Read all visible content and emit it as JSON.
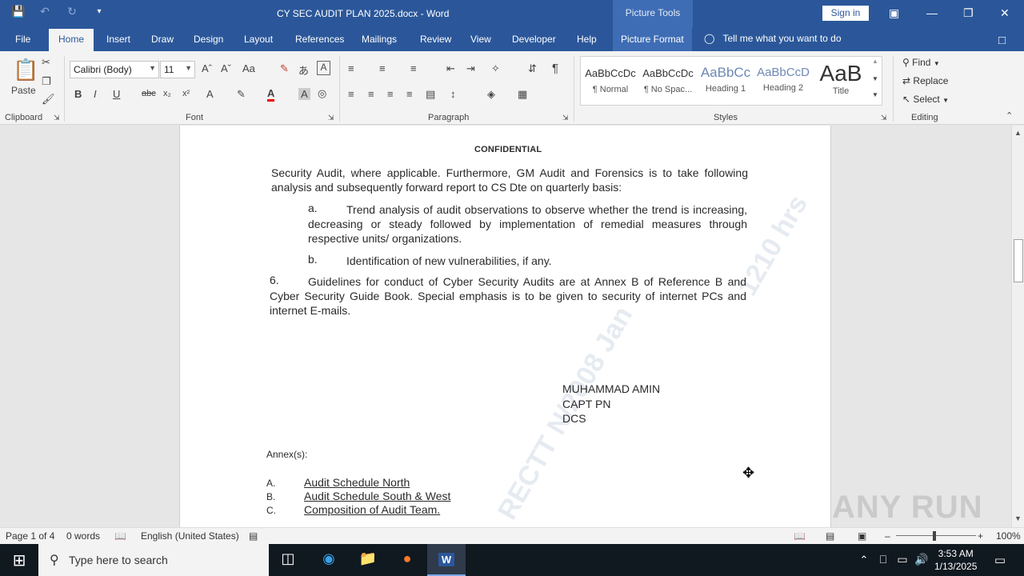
{
  "window": {
    "title": "CY SEC AUDIT PLAN 2025.docx  -  Word",
    "context_tab": "Picture Tools",
    "sign_in": "Sign in"
  },
  "tabs": [
    "File",
    "Home",
    "Insert",
    "Draw",
    "Design",
    "Layout",
    "References",
    "Mailings",
    "Review",
    "View",
    "Developer",
    "Help",
    "Picture Format"
  ],
  "tell_me": "Tell me what you want to do",
  "ribbon": {
    "clipboard": {
      "label": "Clipboard",
      "paste": "Paste"
    },
    "font": {
      "label": "Font",
      "name": "Calibri (Body)",
      "size": "11"
    },
    "paragraph": {
      "label": "Paragraph"
    },
    "styles": {
      "label": "Styles",
      "items": [
        {
          "sample": "AaBbCcDc",
          "name": "¶ Normal"
        },
        {
          "sample": "AaBbCcDc",
          "name": "¶ No Spac..."
        },
        {
          "sample": "AaBbCc",
          "name": "Heading 1"
        },
        {
          "sample": "AaBbCcD",
          "name": "Heading 2"
        },
        {
          "sample": "AaB",
          "name": "Title"
        }
      ]
    },
    "editing": {
      "label": "Editing",
      "find": "Find",
      "replace": "Replace",
      "select": "Select"
    }
  },
  "document": {
    "header": "CONFIDENTIAL",
    "para_intro": "Security Audit, where applicable.  Furthermore, GM Audit and Forensics is to take following analysis and subsequently forward report to CS Dte on quarterly basis:",
    "item_a_letter": "a.",
    "item_a": "Trend analysis of audit observations to observe whether the trend is increasing, decreasing or steady followed by implementation of remedial measures through respective units/ organizations.",
    "item_b_letter": "b.",
    "item_b": "Identification of new vulnerabilities, if any.",
    "para6_num": "6.",
    "para6": "Guidelines for conduct of Cyber Security Audits are at Annex B of Reference B and Cyber Security Guide Book.  Special emphasis is to be given to security of internet PCs and internet E-mails.",
    "signature": {
      "name": "MUHAMMAD AMIN",
      "rank": "CAPT PN",
      "appointment": "DCS"
    },
    "annex_heading": "Annex(s):",
    "annexes": [
      {
        "letter": "A.",
        "title": "Audit Schedule North"
      },
      {
        "letter": "B.",
        "title": "Audit Schedule South & West"
      },
      {
        "letter": "C.",
        "title": "Composition of Audit Team."
      }
    ]
  },
  "status": {
    "page": "Page 1 of 4",
    "words": "0 words",
    "language": "English (United States)",
    "zoom": "100%"
  },
  "watermark_brand": "ANY RUN",
  "taskbar": {
    "search_placeholder": "Type here to search",
    "time": "3:53 AM",
    "date": "1/13/2025"
  }
}
